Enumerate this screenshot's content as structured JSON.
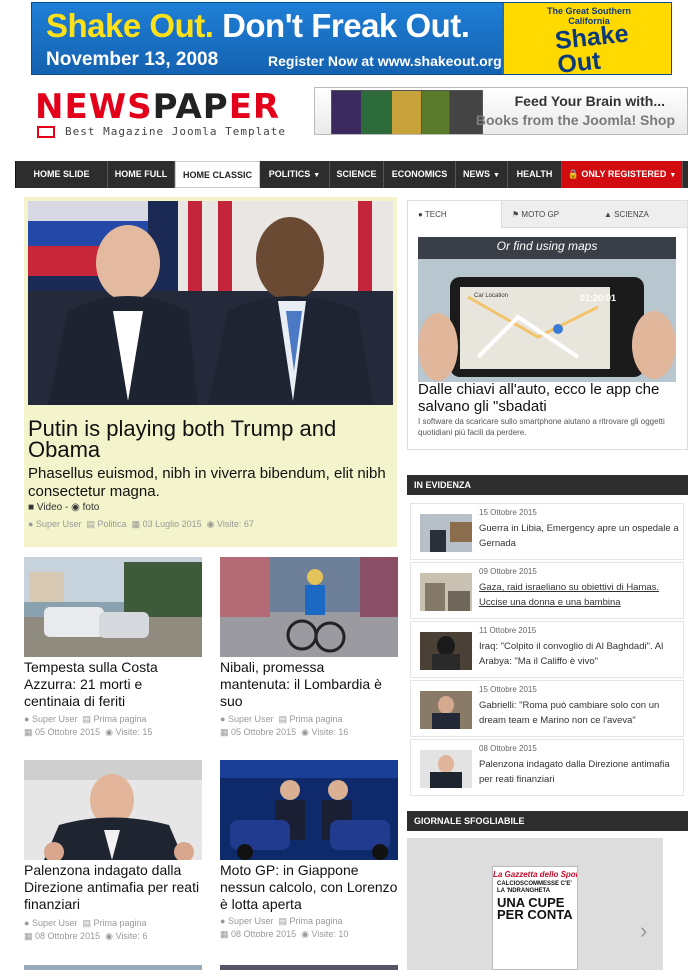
{
  "banner": {
    "title_part1": "Shake Out.",
    "title_part2": "Don't Freak Out.",
    "date": "November 13, 2008",
    "register": "Register Now at www.shakeout.org",
    "great": "The Great Southern California",
    "logo": "Shake Out"
  },
  "logo": {
    "word_red1": "NEWS",
    "word_dark": "PAP",
    "word_red2": "ER",
    "tagline": "Best Magazine Joomla Template"
  },
  "ad_books": {
    "line1": "Feed Your Brain with...",
    "line2": "Books from the Joomla! Shop"
  },
  "nav": {
    "items": [
      {
        "label": "HOME SLIDE"
      },
      {
        "label": "HOME FULL"
      },
      {
        "label": "HOME CLASSIC"
      },
      {
        "label": "POLITICS"
      },
      {
        "label": "SCIENCE"
      },
      {
        "label": "ECONOMICS"
      },
      {
        "label": "NEWS"
      },
      {
        "label": "HEALTH"
      },
      {
        "label": "ONLY REGISTERED"
      }
    ]
  },
  "featured": {
    "title": "Putin is playing both Trump and Obama",
    "subtitle": "Phasellus euismod, nibh in viverra bibendum, elit nibh consectetur magna.",
    "video": "Video",
    "foto": "foto",
    "sep": "-",
    "author": "Super User",
    "category": "Politica",
    "date": "03 Luglio 2015",
    "visits": "Visite: 67"
  },
  "cards": [
    {
      "title": "Tempesta sulla Costa Azzurra: 21 morti e centinaia di feriti",
      "author": "Super User",
      "category": "Prima pagina",
      "date": "05 Ottobre 2015",
      "visits": "Visite: 15"
    },
    {
      "title": "Nibali, promessa mantenuta: il Lombardia è suo",
      "author": "Super User",
      "category": "Prima pagina",
      "date": "05 Ottobre 2015",
      "visits": "Visite: 16"
    },
    {
      "title": "Palenzona indagato dalla Direzione antimafia per reati finanziari",
      "author": "Super User",
      "category": "Prima pagina",
      "date": "08 Ottobre 2015",
      "visits": "Visite: 6"
    },
    {
      "title": "Moto GP: in Giappone nessun calcolo, con Lorenzo è lotta aperta",
      "author": "Super User",
      "category": "Prima pagina",
      "date": "08 Ottobre 2015",
      "visits": "Visite: 10"
    }
  ],
  "tabs": {
    "items": [
      {
        "label": "TECH"
      },
      {
        "label": "MOTO GP"
      },
      {
        "label": "SCIENZA"
      }
    ],
    "image_caption": "Or find using maps",
    "phone_label": "Car Location",
    "phone_time": "01:20:01",
    "article_title": "Dalle chiavi all'auto, ecco le app che salvano gli \"sbadati",
    "article_desc": "I software da scaricare sullo smartphone aiutano a ritrovare gli oggetti quotidiani più facili da perdere."
  },
  "evidenza": {
    "header": "IN EVIDENZA",
    "items": [
      {
        "date": "15 Ottobre 2015",
        "title": "Guerra in Libia, Emergency apre un ospedale a Gernada"
      },
      {
        "date": "09 Ottobre 2015",
        "title": "Gaza, raid israeliano su obiettivi di Hamas. Uccise una donna e una bambina"
      },
      {
        "date": "11 Ottobre 2015",
        "title": "Iraq: \"Colpito il convoglio di Al Baghdadi\". Al Arabya: \"Ma il Califfo è vivo\""
      },
      {
        "date": "15 Ottobre 2015",
        "title": "Gabrielli: \"Roma può cambiare solo con un dream team e Marino non ce l'aveva\""
      },
      {
        "date": "08 Ottobre 2015",
        "title": "Palenzona indagato dalla Direzione antimafia per reati finanziari"
      }
    ]
  },
  "giornale": {
    "header": "GIORNALE SFOGLIABILE",
    "paper_title": "La Gazzetta dello Sport",
    "paper_head": "CALCIOSCOMMESSE C'E' LA 'NDRANGHETA",
    "paper_big": "UNA CUPE PER CONTA"
  },
  "colors": {
    "accent_red": "#d10b10",
    "nav_dark": "#2d2d2d",
    "featured_bg": "#f3f4cb"
  }
}
